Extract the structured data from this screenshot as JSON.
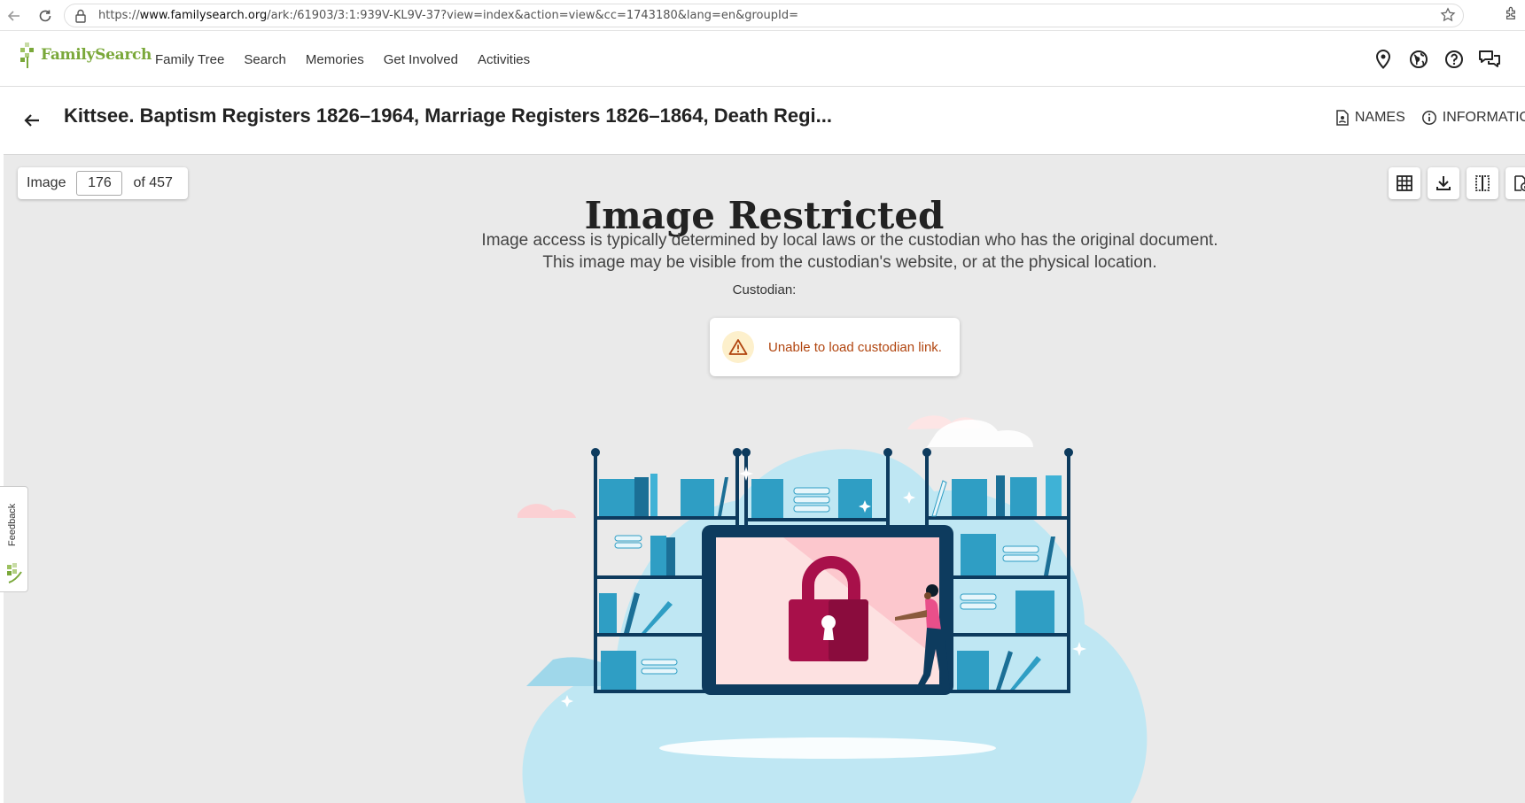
{
  "browser": {
    "url_prefix": "https://",
    "url_domain": "www.familysearch.org",
    "url_rest": "/ark:/61903/3:1:939V-KL9V-37?view=index&action=view&cc=1743180&lang=en&groupId="
  },
  "header": {
    "logo_text": "FamilySearch",
    "nav": [
      "Family Tree",
      "Search",
      "Memories",
      "Get Involved",
      "Activities"
    ],
    "icons": [
      "location-pin-icon",
      "globe-icon",
      "help-icon",
      "chat-icon"
    ]
  },
  "titlebar": {
    "title": "Kittsee. Baptism Registers 1826–1964, Marriage Registers 1826–1864, Death Regi...",
    "names_label": "NAMES",
    "information_label": "INFORMATIO"
  },
  "viewer": {
    "image_label": "Image",
    "image_number": "176",
    "image_total": "of 457",
    "restricted_title": "Image Restricted",
    "restricted_desc": "Image access is typically determined by local laws or the custodian who has the original document. This image may be visible from the custodian's website, or at the physical location.",
    "custodian_label": "Custodian:",
    "alert_text": "Unable to load custodian link.",
    "tools": [
      "grid-icon",
      "download-icon",
      "compare-icon",
      "source-info-icon"
    ]
  },
  "feedback": {
    "label": "Feedback"
  },
  "colors": {
    "brand_green": "#7aa83a",
    "alert_text": "#b1450f",
    "lock_red": "#a8104a",
    "shelf_navy": "#0d3b5e",
    "book_blue": "#2f9ec4"
  }
}
